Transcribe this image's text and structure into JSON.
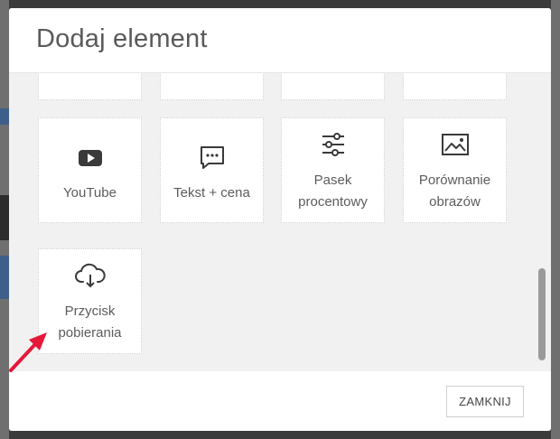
{
  "modal": {
    "title": "Dodaj element",
    "close_label": "ZAMKNIJ"
  },
  "tiles": [
    {
      "label": "YouTube",
      "icon": "youtube-icon"
    },
    {
      "label": "Tekst + cena",
      "icon": "chat-dots-icon"
    },
    {
      "label_line1": "Pasek",
      "label_line2": "procentowy",
      "icon": "sliders-icon"
    },
    {
      "label_line1": "Porównanie",
      "label_line2": "obrazów",
      "icon": "image-icon"
    },
    {
      "label_line1": "Przycisk",
      "label_line2": "pobierania",
      "icon": "cloud-download-icon"
    }
  ],
  "colors": {
    "icon": "#3a3a3a",
    "arrow": "#e5183a",
    "body_bg": "#f1f1f1"
  }
}
